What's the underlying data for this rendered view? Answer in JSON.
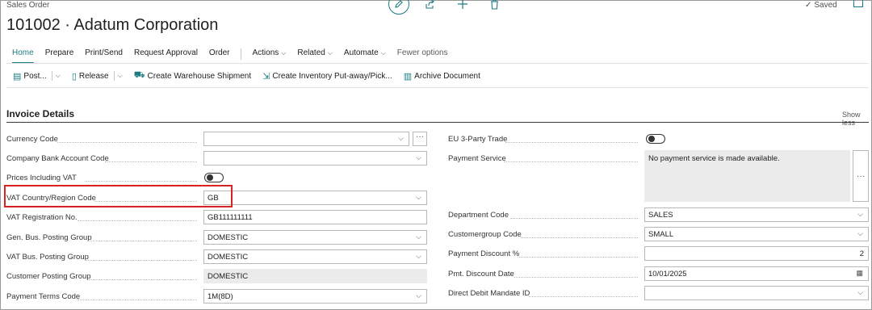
{
  "header": {
    "page_kind": "Sales Order",
    "title": "101002 · Adatum Corporation",
    "saved": "Saved",
    "icons": [
      "edit-icon",
      "share-icon",
      "add-icon",
      "delete-icon",
      "checkmark-icon",
      "popout-icon"
    ]
  },
  "menu": {
    "home": "Home",
    "prepare": "Prepare",
    "print_send": "Print/Send",
    "request_approval": "Request Approval",
    "order": "Order",
    "actions": "Actions",
    "related": "Related",
    "automate": "Automate",
    "fewer_options": "Fewer options"
  },
  "toolbar": {
    "post": "Post...",
    "release": "Release",
    "create_warehouse_shipment": "Create Warehouse Shipment",
    "create_inventory_putaway": "Create Inventory Put-away/Pick...",
    "archive_document": "Archive Document"
  },
  "section": {
    "title": "Invoice Details",
    "show_less": "Show less"
  },
  "left_fields": {
    "currency_code": {
      "label": "Currency Code",
      "value": ""
    },
    "company_bank_account_code": {
      "label": "Company Bank Account Code",
      "value": ""
    },
    "prices_including_vat": {
      "label": "Prices Including VAT",
      "on": false
    },
    "vat_country_region_code": {
      "label": "VAT Country/Region Code",
      "value": "GB"
    },
    "vat_registration_no": {
      "label": "VAT Registration No.",
      "value": "GB111111111"
    },
    "gen_bus_posting_group": {
      "label": "Gen. Bus. Posting Group",
      "value": "DOMESTIC"
    },
    "vat_bus_posting_group": {
      "label": "VAT Bus. Posting Group",
      "value": "DOMESTIC"
    },
    "customer_posting_group": {
      "label": "Customer Posting Group",
      "value": "DOMESTIC"
    },
    "payment_terms_code": {
      "label": "Payment Terms Code",
      "value": "1M(8D)"
    }
  },
  "right_fields": {
    "eu_3_party_trade": {
      "label": "EU 3-Party Trade",
      "on": false
    },
    "payment_service": {
      "label": "Payment Service",
      "value": "No payment service is made available."
    },
    "department_code": {
      "label": "Department Code",
      "value": "SALES"
    },
    "customergroup_code": {
      "label": "Customergroup Code",
      "value": "SMALL"
    },
    "payment_discount_pct": {
      "label": "Payment Discount %",
      "value": "2"
    },
    "pmt_discount_date": {
      "label": "Pmt. Discount Date",
      "value": "10/01/2025"
    },
    "direct_debit_mandate_id": {
      "label": "Direct Debit Mandate ID",
      "value": ""
    }
  },
  "glyphs": {
    "chevron": "⌵",
    "ellipsis": "···",
    "check": "✓",
    "calendar": "▦"
  },
  "colors": {
    "accent": "#1b7a82",
    "highlight_border": "#d72323"
  }
}
